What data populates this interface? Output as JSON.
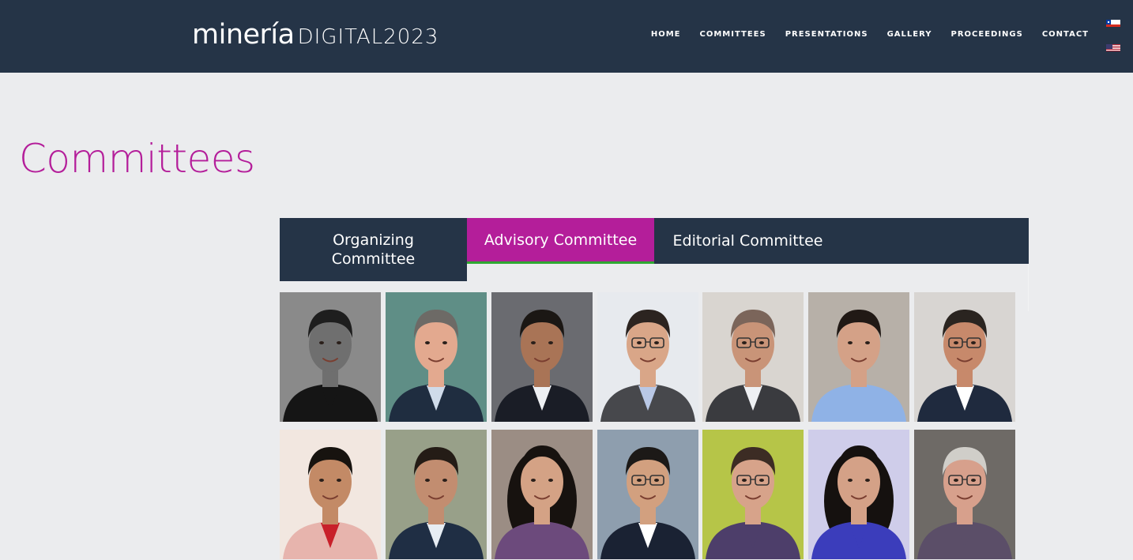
{
  "header": {
    "logo_main": "minería",
    "logo_sub": "DIGITAL2023",
    "nav": [
      "HOME",
      "COMMITTEES",
      "PRESENTATIONS",
      "GALLERY",
      "PROCEEDINGS",
      "CONTACT"
    ],
    "languages": [
      "flag-chile-icon",
      "flag-usa-icon"
    ]
  },
  "page": {
    "title": "Committees"
  },
  "tabs": [
    {
      "label": "Organizing Committee",
      "active": false
    },
    {
      "label": "Advisory Committee",
      "active": true
    },
    {
      "label": "Editorial Committee",
      "active": false
    }
  ],
  "colors": {
    "header_bg": "#253447",
    "accent": "#b41e9a",
    "active_underline": "#2fa832",
    "page_bg": "#ebecee"
  },
  "members": [
    {
      "bg": "#8a8a8a",
      "skin": "#6f6f6f",
      "hair": "#1e1e1e",
      "suit": "#151515",
      "shirt": "#151515",
      "glasses": false,
      "long_hair": false
    },
    {
      "bg": "#5f8e86",
      "skin": "#e3a98f",
      "hair": "#6d6a66",
      "suit": "#1f2d40",
      "shirt": "#cfdbea",
      "glasses": false,
      "long_hair": false
    },
    {
      "bg": "#6a6b70",
      "skin": "#a97456",
      "hair": "#1b1714",
      "suit": "#1a1d26",
      "shirt": "#eef0f3",
      "glasses": false,
      "long_hair": false
    },
    {
      "bg": "#e7eaee",
      "skin": "#d9a688",
      "hair": "#2c2420",
      "suit": "#47484c",
      "shirt": "#b9c8e6",
      "glasses": true,
      "long_hair": false
    },
    {
      "bg": "#d9d5d0",
      "skin": "#c99478",
      "hair": "#7b655a",
      "suit": "#3a3b3f",
      "shirt": "#eef0f3",
      "glasses": true,
      "long_hair": false
    },
    {
      "bg": "#b7b0a8",
      "skin": "#d4a187",
      "hair": "#211915",
      "suit": "#8fb2e6",
      "shirt": "#8fb2e6",
      "glasses": false,
      "long_hair": false
    },
    {
      "bg": "#d8d5d2",
      "skin": "#c7896b",
      "hair": "#2a2420",
      "suit": "#1f2a3e",
      "shirt": "#ffffff",
      "glasses": true,
      "long_hair": false
    },
    {
      "bg": "#f2e7e0",
      "skin": "#c38a66",
      "hair": "#17130f",
      "suit": "#e7b4ad",
      "shirt": "#c8202a",
      "glasses": false,
      "long_hair": false
    },
    {
      "bg": "#98a089",
      "skin": "#c28d70",
      "hair": "#241c16",
      "suit": "#1f2e44",
      "shirt": "#e7edf3",
      "glasses": false,
      "long_hair": false
    },
    {
      "bg": "#9b8d84",
      "skin": "#d4a285",
      "hair": "#17120f",
      "suit": "#6c4a7c",
      "shirt": "#6c4a7c",
      "glasses": false,
      "long_hair": true
    },
    {
      "bg": "#8e9eae",
      "skin": "#d2a07f",
      "hair": "#1c1917",
      "suit": "#1a2233",
      "shirt": "#ffffff",
      "glasses": true,
      "long_hair": false
    },
    {
      "bg": "#b6c548",
      "skin": "#d7a38a",
      "hair": "#3c2c24",
      "suit": "#4d3e6a",
      "shirt": "#4d3e6a",
      "glasses": true,
      "long_hair": false
    },
    {
      "bg": "#cfcdea",
      "skin": "#d4a187",
      "hair": "#15110f",
      "suit": "#3b3dbb",
      "shirt": "#3b3dbb",
      "glasses": false,
      "long_hair": true
    },
    {
      "bg": "#6e6a66",
      "skin": "#d7a08c",
      "hair": "#d0cec9",
      "suit": "#5b4e68",
      "shirt": "#5b4e68",
      "glasses": true,
      "long_hair": false
    }
  ]
}
